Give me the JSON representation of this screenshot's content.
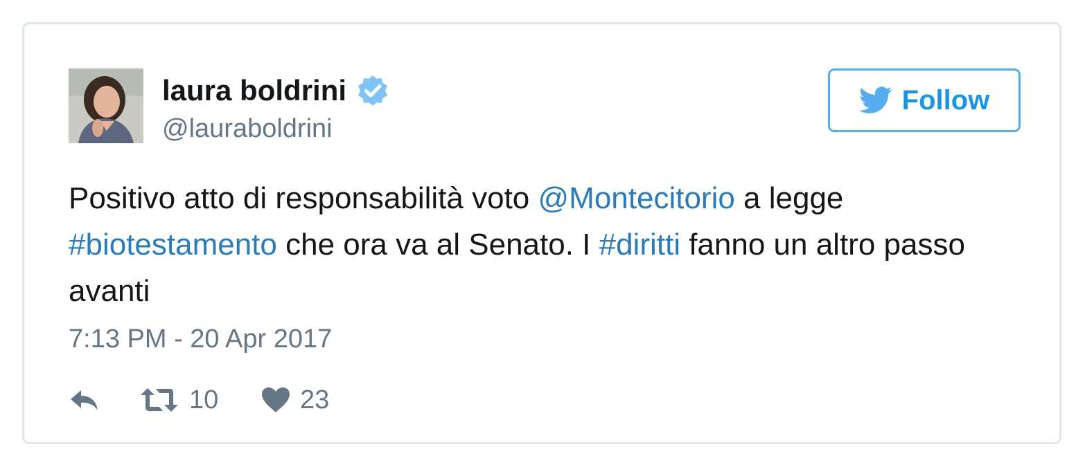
{
  "user": {
    "name": "laura boldrini",
    "handle": "@lauraboldrini",
    "verified": true
  },
  "follow_button": {
    "label": "Follow",
    "icon": "twitter-bird-icon"
  },
  "tweet": {
    "text_parts": {
      "p1": "Positivo atto di responsabilità voto ",
      "mention": "@Montecitorio",
      "p2": " a legge ",
      "hashtag1": "#biotestamento",
      "p3": " che ora va al Senato. I ",
      "hashtag2": "#diritti",
      "p4": " fanno un altro passo avanti"
    },
    "timestamp": "7:13 PM - 20 Apr 2017"
  },
  "actions": {
    "reply_icon": "reply-icon",
    "retweet_icon": "retweet-icon",
    "retweets": "10",
    "like_icon": "heart-icon",
    "likes": "23"
  },
  "colors": {
    "link": "#2b7bb9",
    "follow_accent": "#55acee",
    "verified_badge": "#7fc4f4",
    "muted": "#657786",
    "text": "#14171a",
    "border": "#e1e8ed"
  }
}
